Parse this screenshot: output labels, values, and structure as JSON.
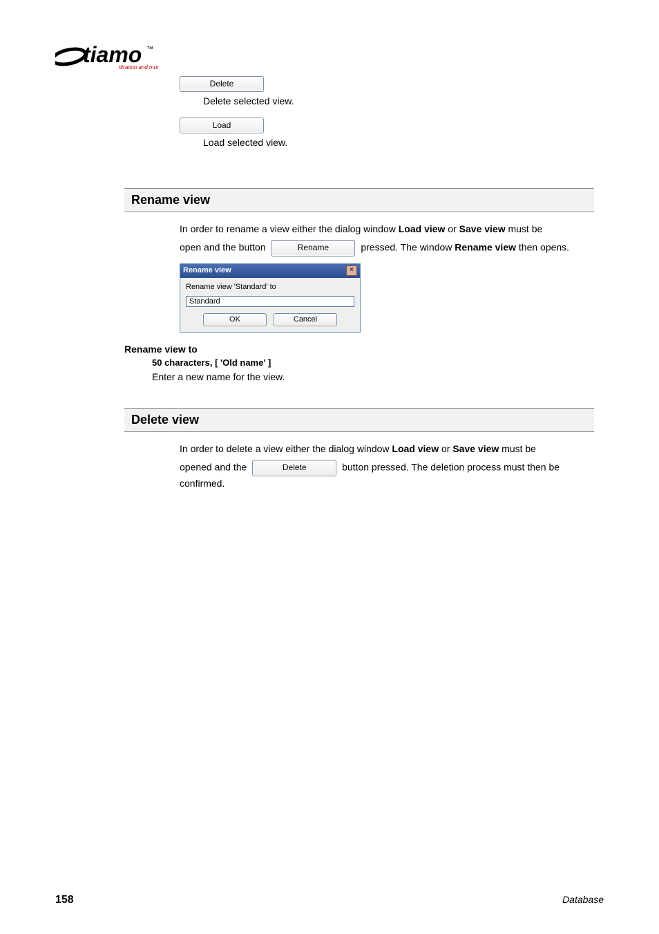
{
  "logo": {
    "main": "tiamo",
    "tagline": "titration and more",
    "tm": "™"
  },
  "top": {
    "delete_btn": "Delete",
    "delete_desc": "Delete selected view.",
    "load_btn": "Load",
    "load_desc": "Load selected view."
  },
  "rename_section": {
    "heading": "Rename view",
    "p1_a": "In order to rename a view either the dialog window ",
    "p1_load": "Load view",
    "p1_or": " or ",
    "p1_save": "Save view",
    "p1_b": " must be",
    "p2_a": "open and the button ",
    "rename_btn": "Rename",
    "p2_b": " pressed. The window ",
    "p2_bold": "Rename view",
    "p2_c": " then opens.",
    "dialog": {
      "title": "Rename view",
      "label": "Rename view 'Standard' to",
      "value": "Standard",
      "ok": "OK",
      "cancel": "Cancel"
    },
    "param": {
      "title": "Rename view to",
      "sub": "50 characters, [ 'Old name' ]",
      "desc": "Enter a new name for the view."
    }
  },
  "delete_section": {
    "heading": "Delete view",
    "p1_a": "In order to delete a view either the dialog window ",
    "p1_load": "Load view",
    "p1_or": " or ",
    "p1_save": "Save view",
    "p1_b": " must be",
    "p2_a": "opened and the ",
    "delete_btn": "Delete",
    "p2_b": " button pressed. The deletion process must then be confirmed."
  },
  "footer": {
    "page": "158",
    "label": "Database"
  }
}
